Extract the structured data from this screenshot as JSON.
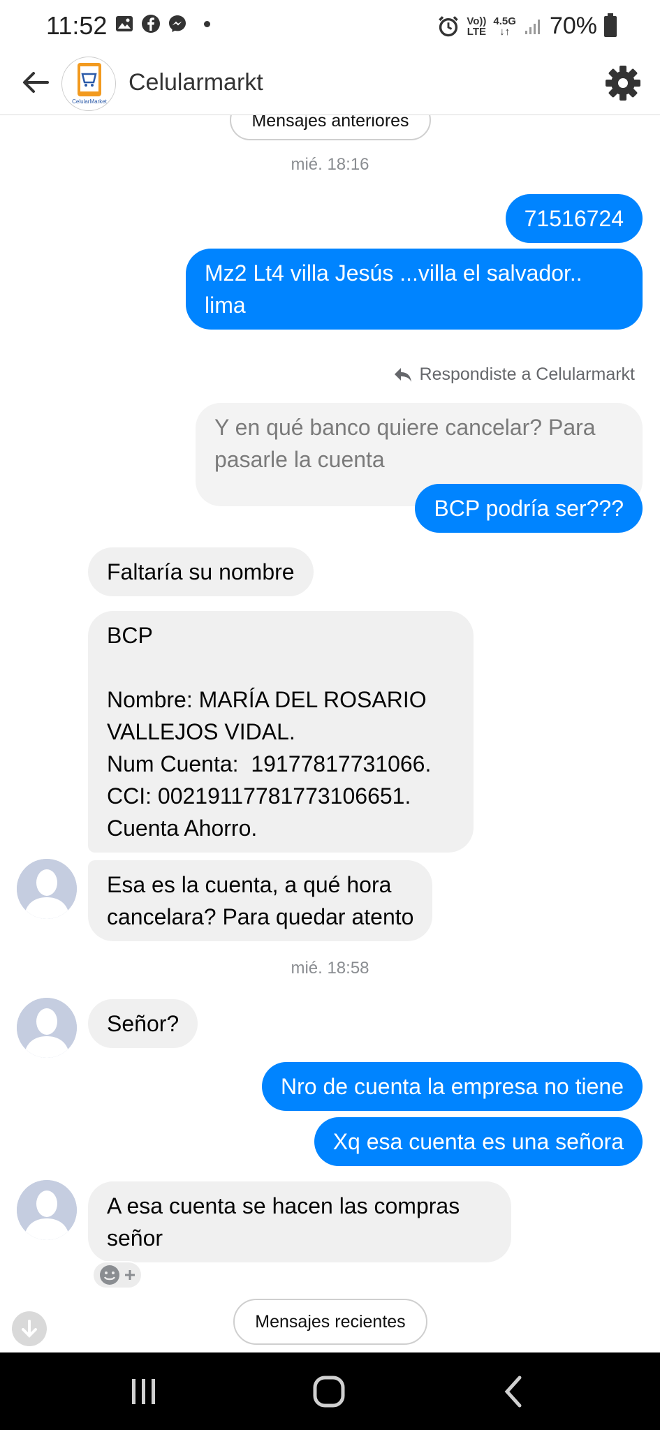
{
  "status_bar": {
    "time": "11:52",
    "network": "4.5G",
    "volte": "Vo))\nLTE",
    "battery": "70%"
  },
  "header": {
    "title": "Celularmarkt",
    "logo_text": "CelularMarket"
  },
  "chat": {
    "older_button": "Mensajes anteriores",
    "timestamp_1": "mié. 18:16",
    "msg_1": "71516724",
    "msg_2": "Mz2 Lt4 villa Jesús ...villa el salvador..\nlima",
    "reply_label": "Respondiste a Celularmarkt",
    "reply_quote": "Y en qué banco quiere cancelar? Para\npasarle la cuenta",
    "msg_3": "BCP podría ser???",
    "msg_4": "Faltaría su nombre",
    "msg_5": "BCP\n\nNombre: MARÍA DEL ROSARIO\nVALLEJOS VIDAL.\nNum Cuenta:  19177817731066.\nCCI: 00219117781773106651.\nCuenta Ahorro.",
    "msg_6": "Esa es la cuenta, a qué hora\ncancelara? Para quedar atento",
    "timestamp_2": "mié. 18:58",
    "msg_7": "Señor?",
    "msg_8": "Nro de cuenta la empresa no tiene",
    "msg_9": "Xq esa cuenta es una señora",
    "msg_10": "A esa cuenta se hacen las compras\nseñor",
    "recent_button": "Mensajes recientes"
  },
  "colors": {
    "outgoing": "#0084ff",
    "incoming": "#f0f0f0",
    "navbar": "#000000"
  }
}
